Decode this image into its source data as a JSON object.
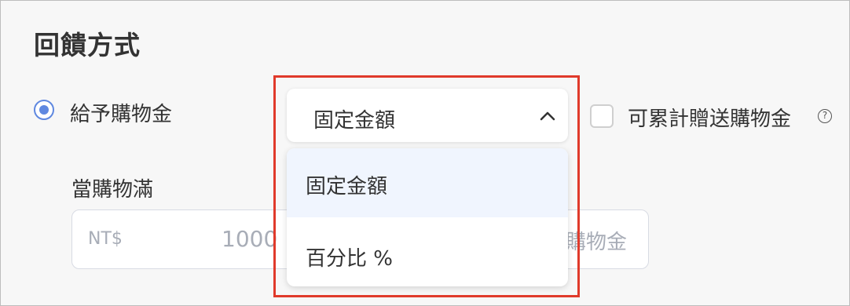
{
  "section": {
    "title": "回饋方式"
  },
  "reward_option": {
    "label": "給予購物金",
    "selected": true
  },
  "reward_type_select": {
    "value": "固定金額",
    "options": [
      "固定金額",
      "百分比 %"
    ],
    "active_option": "固定金額",
    "expanded": true
  },
  "cumulative": {
    "label": "可累計贈送購物金",
    "checked": false,
    "help_icon": "?"
  },
  "min_purchase": {
    "label": "當購物滿",
    "currency": "NT$",
    "placeholder": "1000",
    "suffix": "購物金"
  },
  "colors": {
    "accent": "#5f88e0",
    "highlight": "#e03a2b",
    "option_hover": "#f0f5fe"
  }
}
